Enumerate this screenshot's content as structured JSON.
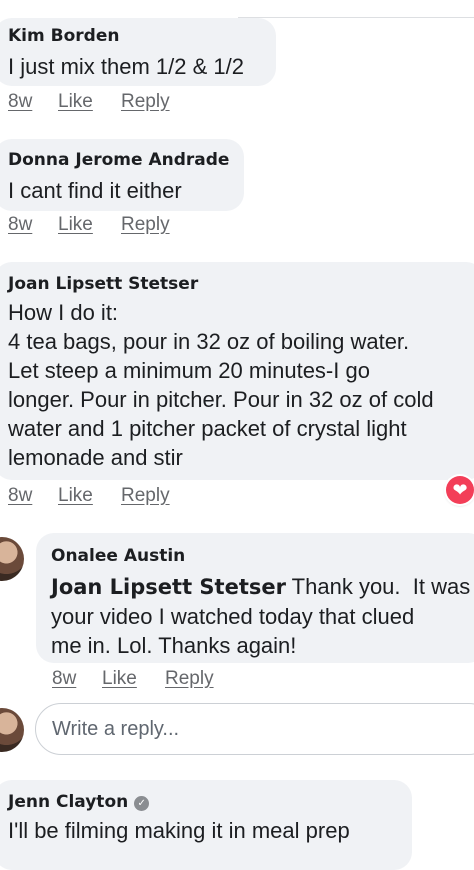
{
  "comments": [
    {
      "author": "Kim Borden",
      "text": "I just mix them 1/2 & 1/2",
      "time": "8w",
      "like": "Like",
      "reply": "Reply"
    },
    {
      "author": "Donna Jerome Andrade",
      "text": "I cant find it either",
      "time": "8w",
      "like": "Like",
      "reply": "Reply"
    },
    {
      "author": "Joan Lipsett Stetser",
      "text": "How I do it:\n4 tea bags, pour in 32 oz of boiling water.\nLet steep a minimum 20 minutes-I go\nlonger. Pour in pitcher. Pour in 32 oz of cold\nwater and 1 pitcher packet of crystal light\nlemonade and stir",
      "time": "8w",
      "like": "Like",
      "reply": "Reply",
      "reaction_icon": "heart-icon"
    },
    {
      "author": "Onalee Austin",
      "mention": "Joan Lipsett Stetser",
      "text_line1": " Thank you.  It was",
      "text_rest": "your video I watched today that clued\nme in. Lol.  Thanks again!",
      "time": "8w",
      "like": "Like",
      "reply": "Reply"
    },
    {
      "author": "Jenn Clayton",
      "badge_icon": "verified-shield-icon",
      "text": "I'll be filming making it in meal prep"
    }
  ],
  "reply_box": {
    "placeholder": "Write a reply..."
  },
  "colors": {
    "bubble": "#f0f2f5",
    "meta": "#65676b",
    "heart": "#f33e58"
  }
}
